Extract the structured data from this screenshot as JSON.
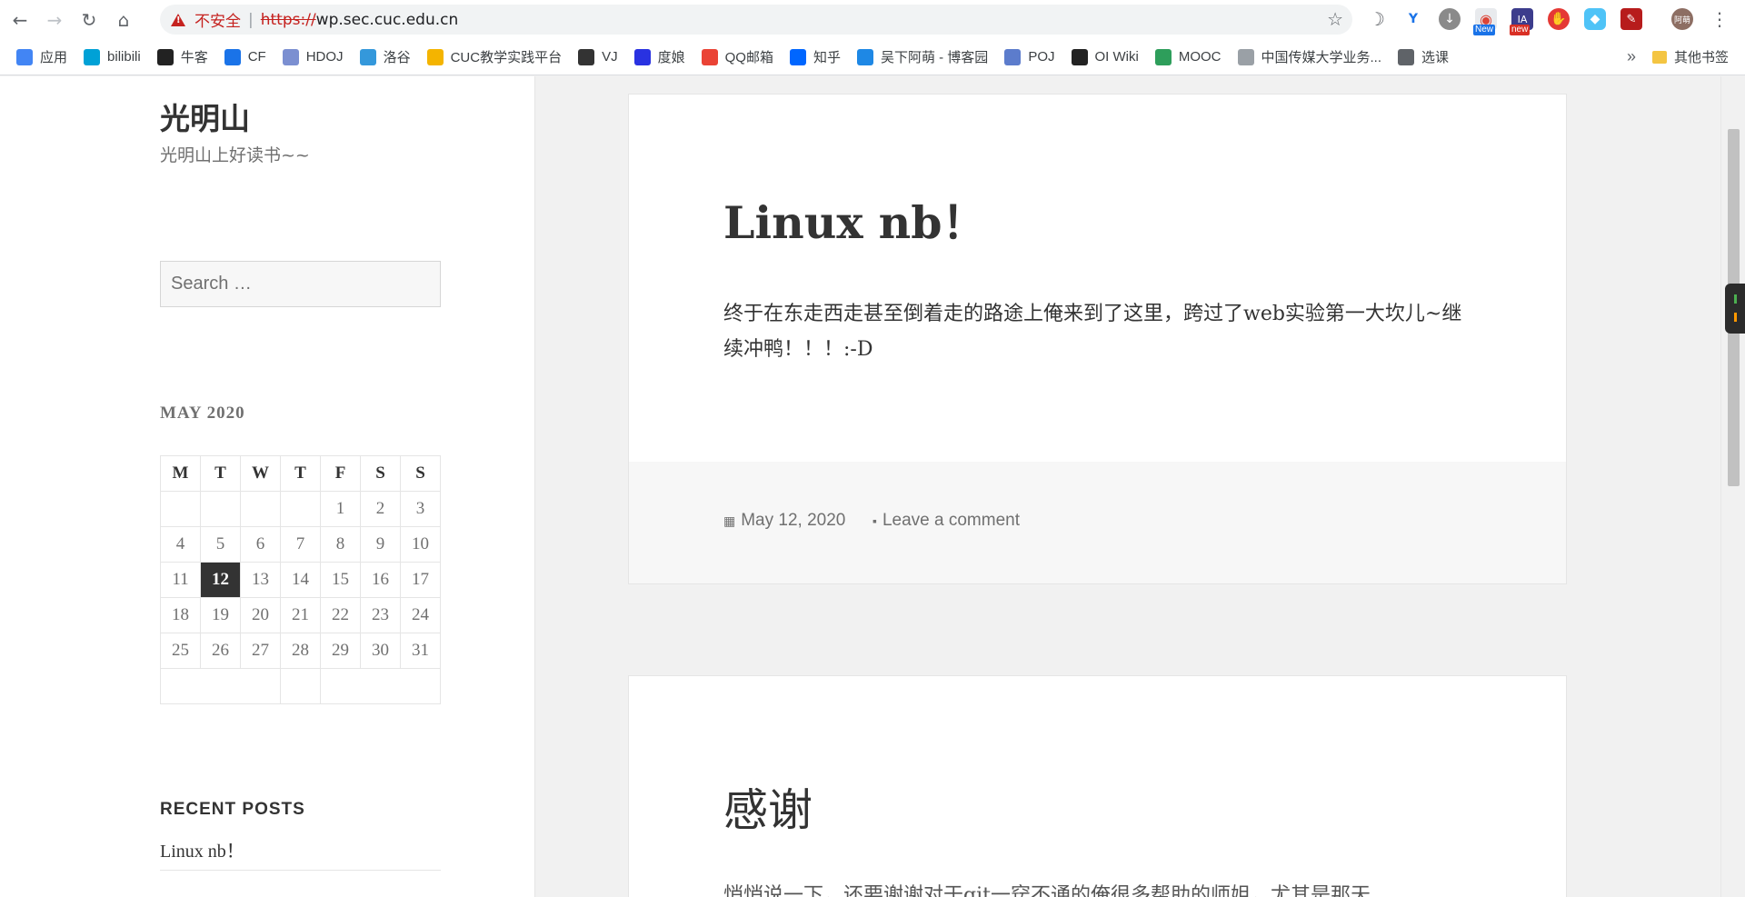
{
  "browser": {
    "address_insecure_label": "不安全",
    "address_separator": "|",
    "address_scheme": "https://",
    "address_host": "wp.sec.cuc.edu.cn",
    "avatar_text": "阿萌",
    "ext_badge_new_1": "New",
    "ext_badge_new_2": "new"
  },
  "bookmarks": {
    "items": [
      {
        "label": "应用",
        "icon": "apps-grid-icon",
        "color": "#4285f4"
      },
      {
        "label": "bilibili",
        "icon": "bilibili-icon",
        "color": "#00a1d6"
      },
      {
        "label": "牛客",
        "icon": "nowcoder-icon",
        "color": "#222222"
      },
      {
        "label": "CF",
        "icon": "codeforces-icon",
        "color": "#1a73e8"
      },
      {
        "label": "HDOJ",
        "icon": "hdoj-icon",
        "color": "#7b8fd1"
      },
      {
        "label": "洛谷",
        "icon": "luogu-icon",
        "color": "#3498db"
      },
      {
        "label": "CUC教学实践平台",
        "icon": "cuc-icon",
        "color": "#f4b400"
      },
      {
        "label": "VJ",
        "icon": "vjudge-icon",
        "color": "#333333"
      },
      {
        "label": "度娘",
        "icon": "baidu-paw-icon",
        "color": "#2932e1"
      },
      {
        "label": "QQ邮箱",
        "icon": "qq-mail-icon",
        "color": "#ea4335"
      },
      {
        "label": "知乎",
        "icon": "zhihu-icon",
        "color": "#0066ff"
      },
      {
        "label": "吴下阿萌 - 博客园",
        "icon": "cnblogs-icon",
        "color": "#1e88e5"
      },
      {
        "label": "POJ",
        "icon": "poj-icon",
        "color": "#5c7ccc"
      },
      {
        "label": "OI Wiki",
        "icon": "graduation-cap-icon",
        "color": "#222222"
      },
      {
        "label": "MOOC",
        "icon": "mooc-icon",
        "color": "#2e9e5b"
      },
      {
        "label": "中国传媒大学业务...",
        "icon": "house-icon",
        "color": "#9aa0a6"
      },
      {
        "label": "选课",
        "icon": "globe-icon",
        "color": "#5f6368"
      }
    ],
    "more": "»",
    "other_label": "其他书签"
  },
  "sidebar": {
    "site_title": "光明山",
    "site_description": "光明山上好读书~~",
    "search_placeholder": "Search …",
    "calendar": {
      "caption": "MAY 2020",
      "headers": [
        "M",
        "T",
        "W",
        "T",
        "F",
        "S",
        "S"
      ],
      "rows": [
        [
          "",
          "",
          "",
          "",
          "1",
          "2",
          "3"
        ],
        [
          "4",
          "5",
          "6",
          "7",
          "8",
          "9",
          "10"
        ],
        [
          "11",
          "12",
          "13",
          "14",
          "15",
          "16",
          "17"
        ],
        [
          "18",
          "19",
          "20",
          "21",
          "22",
          "23",
          "24"
        ],
        [
          "25",
          "26",
          "27",
          "28",
          "29",
          "30",
          "31"
        ]
      ],
      "today": "12"
    },
    "recent_posts_title": "RECENT POSTS",
    "recent_posts": [
      "Linux nb！"
    ]
  },
  "posts": [
    {
      "title": "Linux nb！",
      "body": "终于在东走西走甚至倒着走的路途上俺来到了这里，跨过了web实验第一大坎儿~继续冲鸭！！！:-D",
      "date": "May 12, 2020",
      "comment_link": "Leave a comment"
    },
    {
      "title": "感谢",
      "body": "悄悄说一下，还要谢谢对于git一窍不通的俺很多帮助的师姐，尤其是那天"
    }
  ]
}
